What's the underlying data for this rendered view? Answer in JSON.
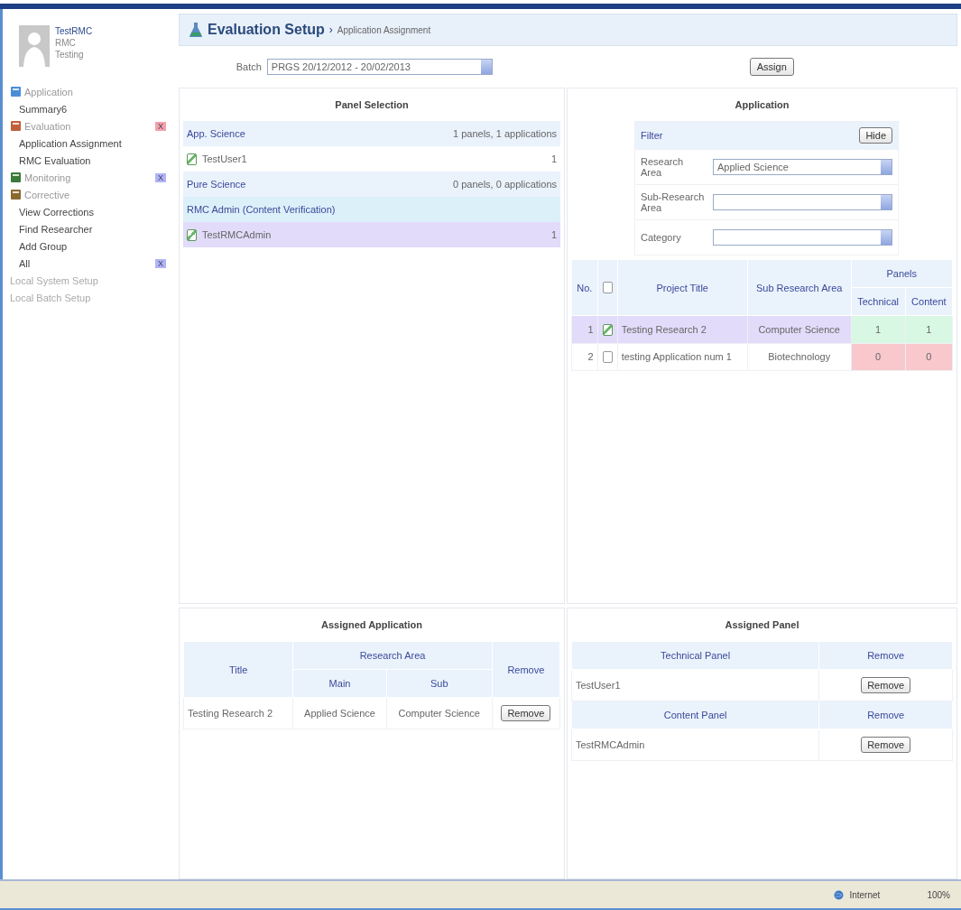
{
  "user": {
    "name": "TestRMC",
    "role": "RMC",
    "org": "Testing"
  },
  "sidebar": {
    "items": [
      {
        "kind": "section",
        "label": "Application"
      },
      {
        "kind": "link",
        "label": "Summary6"
      },
      {
        "kind": "section",
        "label": "Evaluation",
        "badge": {
          "text": "X",
          "color": "#f4a0a8"
        }
      },
      {
        "kind": "link",
        "label": "Application Assignment"
      },
      {
        "kind": "link",
        "label": "RMC Evaluation"
      },
      {
        "kind": "section",
        "label": "Monitoring",
        "badge": {
          "text": "X",
          "color": "#b0b4f4"
        }
      },
      {
        "kind": "section",
        "label": "Corrective"
      },
      {
        "kind": "link",
        "label": "View Corrections"
      },
      {
        "kind": "link",
        "label": "Find Researcher"
      },
      {
        "kind": "link",
        "label": "Add Group"
      },
      {
        "kind": "link",
        "label": "All",
        "badge": {
          "text": "X",
          "color": "#b0b4f4"
        }
      },
      {
        "kind": "disabled",
        "label": "Local System Setup"
      },
      {
        "kind": "disabled",
        "label": "Local Batch Setup"
      }
    ]
  },
  "header": {
    "title": "Evaluation Setup",
    "separator": "›",
    "subtitle": "Application Assignment"
  },
  "batch": {
    "label": "Batch",
    "value": "PRGS 20/12/2012 - 20/02/2013"
  },
  "assign_button": "Assign",
  "panel_selection": {
    "title": "Panel Selection",
    "rows": [
      {
        "kind": "group",
        "name": "App. Science",
        "summary": "1 panels, 1 applications"
      },
      {
        "kind": "member",
        "name": "TestUser1",
        "count": "1",
        "checked": true,
        "selected": false
      },
      {
        "kind": "group",
        "name": "Pure Science",
        "summary": "0 panels, 0 applications"
      },
      {
        "kind": "subgroup",
        "name": "RMC Admin (Content Verification)"
      },
      {
        "kind": "member",
        "name": "TestRMCAdmin",
        "count": "1",
        "checked": true,
        "selected": true
      }
    ]
  },
  "application": {
    "title": "Application",
    "filter": {
      "title": "Filter",
      "hide_button": "Hide",
      "fields": [
        {
          "label": "Research Area",
          "value": "Applied Science"
        },
        {
          "label": "Sub-Research Area"
        },
        {
          "label": "Category"
        }
      ]
    },
    "columns": {
      "no": "No.",
      "project_title": "Project Title",
      "sub_area": "Sub Research Area",
      "panels": "Panels",
      "technical": "Technical",
      "content": "Content"
    },
    "header_checked": false,
    "rows": [
      {
        "no": "1",
        "checked": true,
        "selected": true,
        "title": "Testing Research 2",
        "sub_area": "Computer Science",
        "technical": "1",
        "content": "1",
        "assigned": true
      },
      {
        "no": "2",
        "checked": false,
        "selected": false,
        "title": "testing Application num 1",
        "sub_area": "Biotechnology",
        "technical": "0",
        "content": "0",
        "assigned": false
      }
    ]
  },
  "assigned_application": {
    "title": "Assigned Application",
    "columns": {
      "title": "Title",
      "research_area": "Research Area",
      "main": "Main",
      "sub": "Sub",
      "remove": "Remove"
    },
    "rows": [
      {
        "title": "Testing Research 2",
        "main": "Applied Science",
        "sub": "Computer Science",
        "remove": "Remove"
      }
    ]
  },
  "assigned_panel": {
    "title": "Assigned Panel",
    "sections": [
      {
        "heading": "Technical Panel",
        "remove_heading": "Remove",
        "rows": [
          {
            "name": "TestUser1",
            "remove": "Remove"
          }
        ]
      },
      {
        "heading": "Content Panel",
        "remove_heading": "Remove",
        "rows": [
          {
            "name": "TestRMCAdmin",
            "remove": "Remove"
          }
        ]
      }
    ]
  },
  "status_bar": {
    "zone": "Internet",
    "zoom": "100%"
  }
}
